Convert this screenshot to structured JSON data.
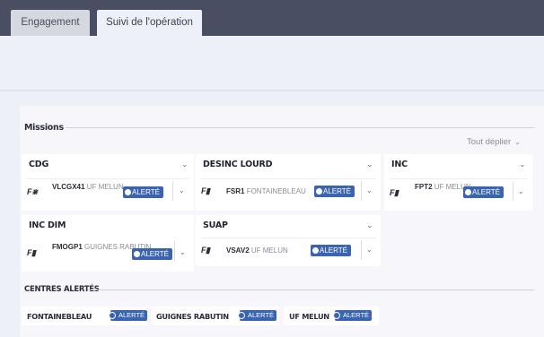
{
  "tabs": [
    {
      "label": "Engagement"
    },
    {
      "label": "Suivi de l'opération"
    }
  ],
  "missions": {
    "title": "Missions",
    "expand_all": "Tout déplier",
    "cards": [
      {
        "title": "CDG",
        "vehicle": {
          "code": "VLCGX41",
          "unit": "UF MELUN"
        },
        "alert": "ALERTÉ"
      },
      {
        "title": "DESINC LOURD",
        "vehicle": {
          "code": "FSR1",
          "unit": "FONTAINEBLEAU"
        },
        "alert": "ALERTÉ"
      },
      {
        "title": "INC",
        "vehicle": {
          "code": "FPT2",
          "unit": "UF MELUN"
        },
        "alert": "ALERTÉ"
      },
      {
        "title": "INC DIM",
        "vehicle": {
          "code": "FMOGP1",
          "unit": "GUIGNES RABUTIN"
        },
        "alert": "ALERTÉ"
      },
      {
        "title": "SUAP",
        "vehicle": {
          "code": "VSAV2",
          "unit": "UF MELUN"
        },
        "alert": "ALERTÉ"
      }
    ]
  },
  "centres": {
    "title": "CENTRES ALERTÉS",
    "items": [
      {
        "name": "FONTAINEBLEAU",
        "status": "ALERTÉ"
      },
      {
        "name": "GUIGNES RABUTIN",
        "status": "ALERTÉ"
      },
      {
        "name": "UF MELUN",
        "status": "ALERTÉ"
      }
    ]
  },
  "icons": {
    "vehicle_small": "car-icon",
    "vehicle_truck": "truck-icon",
    "chevron": "chevron-down-icon"
  },
  "colors": {
    "header": "#4a4e62",
    "alert": "#3a64b0",
    "background": "#eef0f7"
  }
}
